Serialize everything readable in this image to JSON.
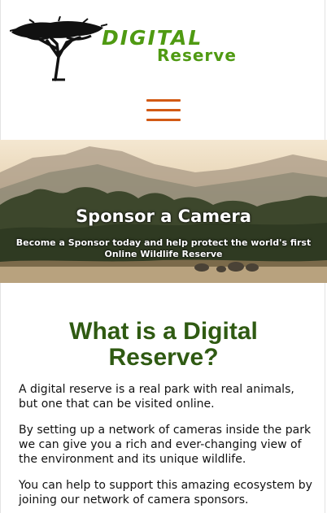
{
  "logo": {
    "word1": "DIGITAL",
    "word2": "Reserve",
    "icon": "acacia-tree-logo",
    "colors": {
      "text": "#4f9a12",
      "tree": "#111111"
    }
  },
  "menu": {
    "icon": "hamburger-menu-icon",
    "color": "#d25a14"
  },
  "hero": {
    "title": "Sponsor a Camera",
    "subtitle": "Become a Sponsor today and help protect the world's first Online Wildlife Reserve"
  },
  "section": {
    "heading": "What is a Digital Reserve?",
    "heading_color": "#2f5a12",
    "paragraphs": [
      "A digital reserve is a real park with real animals, but one that can be visited online.",
      "By setting up a network of cameras inside the park we can give you a rich and ever-changing view of the environment and its unique wildlife.",
      "You can help to support this amazing ecosystem by joining our network of camera sponsors."
    ]
  }
}
